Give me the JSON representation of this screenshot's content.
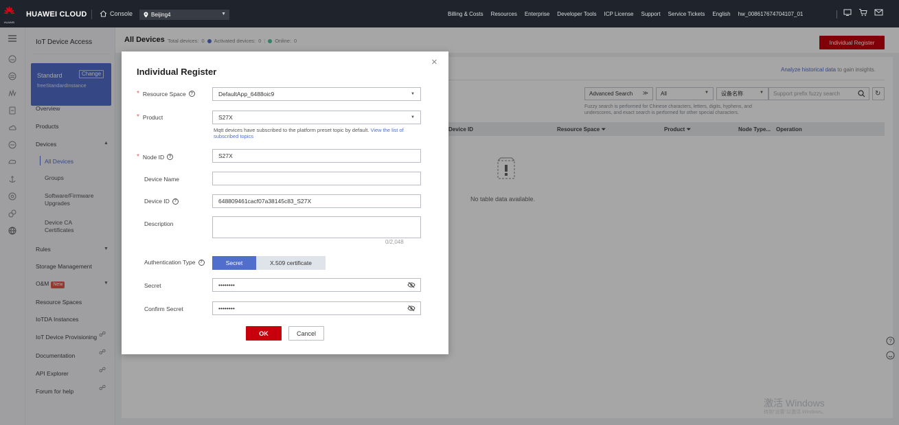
{
  "topbar": {
    "logo_text": "HUAWEI",
    "brand": "HUAWEI CLOUD",
    "console": "Console",
    "region": "Beijing4",
    "menu": [
      "Billing & Costs",
      "Resources",
      "Enterprise",
      "Developer Tools",
      "ICP License",
      "Support",
      "Service Tickets",
      "English",
      "hw_008617674704107_01"
    ]
  },
  "sidebar": {
    "title": "IoT Device Access",
    "instance": {
      "edition": "Standard",
      "change_label": "Change",
      "id": "freeStandardInstance"
    },
    "items": {
      "overview": "Overview",
      "products": "Products",
      "devices": "Devices",
      "all_devices": "All Devices",
      "groups": "Groups",
      "software_firmware_1": "Software/Firmware",
      "software_firmware_2": "Upgrades",
      "device_ca_1": "Device CA",
      "device_ca_2": "Certificates",
      "rules": "Rules",
      "storage_management": "Storage Management",
      "om": "O&M",
      "om_badge": "New",
      "resource_spaces": "Resource Spaces",
      "iotda_instances": "IoTDA Instances",
      "iot_device_provisioning": "IoT Device Provisioning",
      "documentation": "Documentation",
      "api_explorer": "API Explorer",
      "forum_for_help": "Forum for help"
    }
  },
  "main": {
    "title": "All Devices",
    "stats": {
      "total_label": "Total devices:",
      "total_value": "0",
      "activated_label": "Activated devices:",
      "activated_value": "0",
      "online_label": "Online:",
      "online_value": "0"
    },
    "register_button": "Individual Register",
    "analyze_link": "Analyze historical data",
    "analyze_suffix": "to gain insights.",
    "filters": {
      "advanced_search": "Advanced Search",
      "scope": "All",
      "field": "设备名称",
      "search_placeholder": "Support prefix fuzzy search"
    },
    "hint_1": "Fuzzy search is performed for Chinese characters, letters, digits, hyphens, and",
    "hint_2": "underscores, and exact search is performed for other special characters.",
    "columns": [
      "Device ID",
      "Resource Space",
      "Product",
      "Node Type...",
      "Operation"
    ],
    "empty_text": "No table data available."
  },
  "watermark": {
    "line1": "激活 Windows",
    "line2": "转到\"设置\"以激活 Windows。"
  },
  "modal": {
    "title": "Individual Register",
    "fields": {
      "resource_space": {
        "label": "Resource Space",
        "value": "DefaultApp_6488oic9"
      },
      "product": {
        "label": "Product",
        "value": "S27X"
      },
      "product_help": "Mqtt devices have subscribed to the platform preset topic by default.",
      "product_help_link_1": "View the list of",
      "product_help_link_2": "subscribed topics",
      "node_id": {
        "label": "Node ID",
        "value": "S27X"
      },
      "device_name": {
        "label": "Device Name",
        "value": ""
      },
      "device_id": {
        "label": "Device ID",
        "value": "648809461cacf07a38145c83_S27X"
      },
      "description": {
        "label": "Description",
        "value": "",
        "counter": "0/2,048"
      },
      "auth_type": {
        "label": "Authentication Type",
        "options": [
          "Secret",
          "X.509 certificate"
        ],
        "selected": "Secret"
      },
      "secret": {
        "label": "Secret",
        "value": "••••••••"
      },
      "confirm_secret": {
        "label": "Confirm Secret",
        "value": "••••••••"
      }
    },
    "ok": "OK",
    "cancel": "Cancel",
    "close": "×"
  },
  "colors": {
    "accent": "#526ecc",
    "primary_button": "#c7000b",
    "topbar": "#1f232b",
    "required": "#e5574b"
  }
}
